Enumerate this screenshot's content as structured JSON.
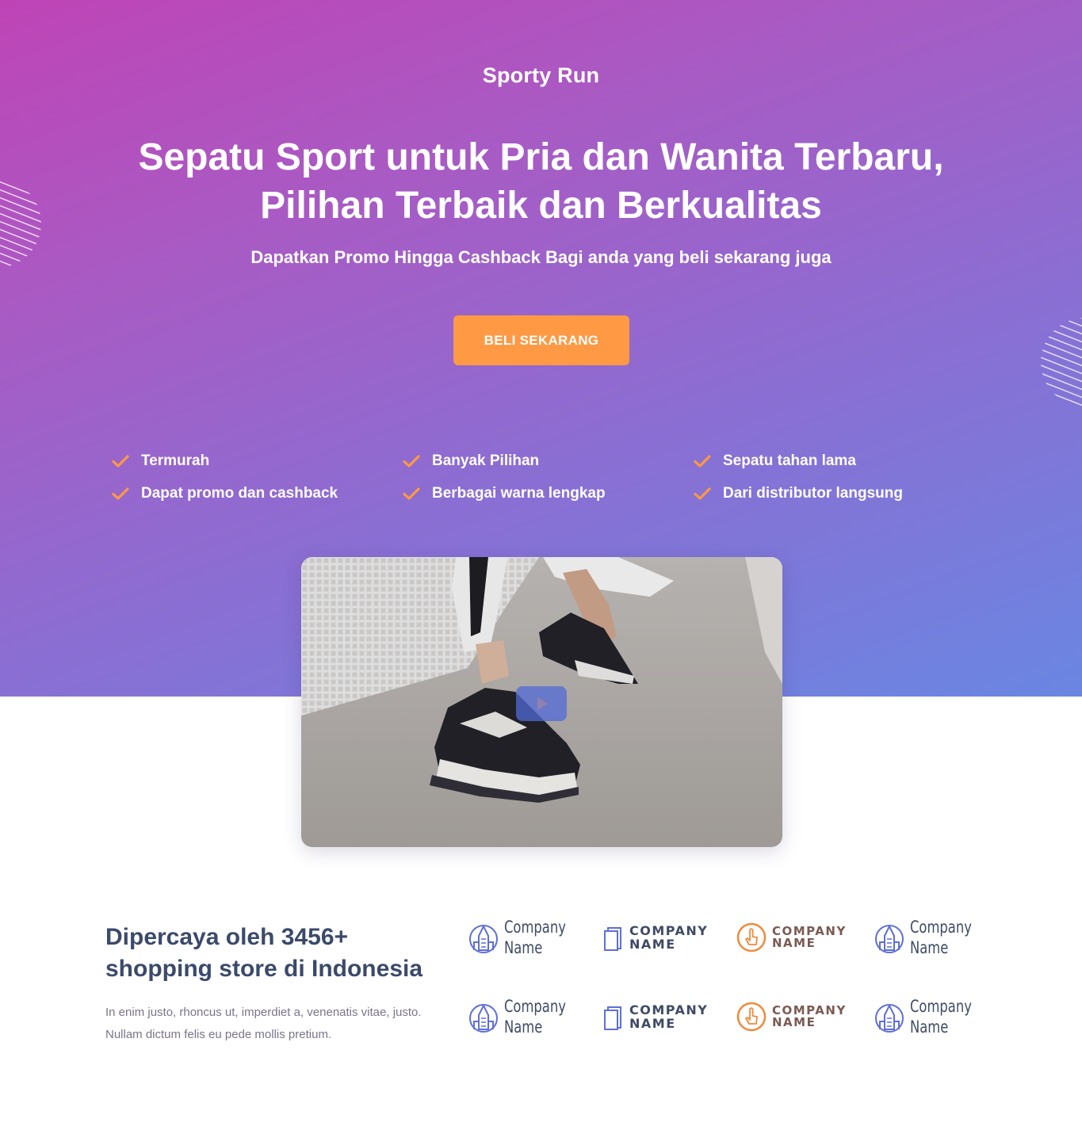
{
  "brand": "Sporty Run",
  "hero": {
    "headline": "Sepatu Sport untuk Pria dan Wanita Terbaru, Pilihan Terbaik dan Berkualitas",
    "subheadline": "Dapatkan Promo Hingga Cashback Bagi anda yang beli sekarang juga",
    "cta_label": "BELI SEKARANG"
  },
  "features": [
    {
      "label": "Termurah",
      "icon": "check-icon"
    },
    {
      "label": "Banyak Pilihan",
      "icon": "check-icon"
    },
    {
      "label": "Sepatu tahan lama",
      "icon": "check-icon"
    },
    {
      "label": "Dapat promo dan cashback",
      "icon": "check-icon"
    },
    {
      "label": "Berbagai warna lengkap",
      "icon": "check-icon"
    },
    {
      "label": "Dari distributor langsung",
      "icon": "check-icon"
    }
  ],
  "video": {
    "icon": "play-icon"
  },
  "trusted": {
    "title": "Dipercaya oleh 3456+ shopping store di Indonesia",
    "description": "In enim justo, rhoncus ut, imperdiet a, venenatis vitae, justo. Nullam dictum felis eu pede mollis pretium."
  },
  "logos": [
    {
      "line1": "Company",
      "line2": "Name",
      "icon": "building-icon"
    },
    {
      "line1": "COMPANY",
      "line2": "NAME",
      "icon": "document-icon"
    },
    {
      "line1": "COMPANY",
      "line2": "NAME",
      "icon": "hand-pointer-icon"
    },
    {
      "line1": "Company",
      "line2": "Name",
      "icon": "building-icon"
    },
    {
      "line1": "Company",
      "line2": "Name",
      "icon": "building-icon"
    },
    {
      "line1": "COMPANY",
      "line2": "NAME",
      "icon": "document-icon"
    },
    {
      "line1": "COMPANY",
      "line2": "NAME",
      "icon": "hand-pointer-icon"
    },
    {
      "line1": "Company",
      "line2": "Name",
      "icon": "building-icon"
    }
  ],
  "colors": {
    "gradient_start": "#bf44b6",
    "gradient_end": "#6a86e2",
    "accent": "#ff9944",
    "heading_dark": "#3b4a6b",
    "logo_blue": "#5e6fd6",
    "logo_orange": "#f08a3c"
  }
}
